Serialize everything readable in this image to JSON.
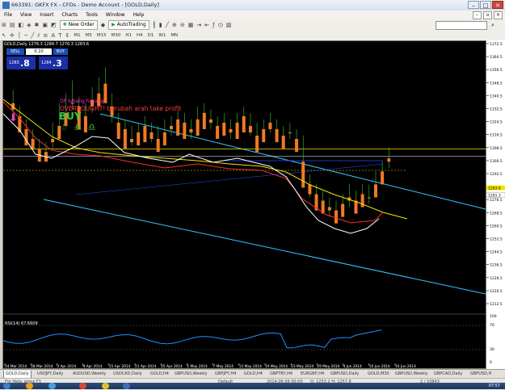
{
  "window": {
    "title": "663391: GKFX FX - CFDs - Demo Account - [GOLD,Daily]"
  },
  "menu": [
    "File",
    "View",
    "Insert",
    "Charts",
    "Tools",
    "Window",
    "Help"
  ],
  "toolbar": {
    "new_order": "New Order",
    "autotrading": "AutoTrading"
  },
  "timeframes": [
    "M1",
    "M5",
    "M15",
    "M30",
    "H1",
    "H4",
    "D1",
    "W1",
    "MN"
  ],
  "chart": {
    "header": "GOLD,Daily 1276.3 1284.7 1276.3 1283.6",
    "trade": {
      "sell": "SELL",
      "buy": "BUY",
      "lot": "0.10",
      "bid_small": "1283",
      "bid_big": ".8",
      "ask_small": "1284",
      "ask_big": ".3"
    },
    "annotations": {
      "line1": "OP lubang hasang",
      "line2": "OVERBOUGHT! berubah arah take profit",
      "line3": "BUY",
      "glyphs": "☃ ♎ ♎"
    },
    "price_labels": [
      "1372.5",
      "1364.5",
      "1356.5",
      "1348.5",
      "1340.5",
      "1332.5",
      "1324.5",
      "1316.5",
      "1308.5",
      "1300.5",
      "1292.5",
      "1284.5",
      "1276.5",
      "1268.5",
      "1260.5",
      "1252.5",
      "1244.5",
      "1236.5",
      "1228.5",
      "1220.5",
      "1212.5"
    ],
    "current_price": "1283.8",
    "current_price2": "1281.3",
    "date_labels": [
      "24 Mar 2014",
      "28 Mar 2014",
      "3 Apr 2014",
      "9 Apr 2014",
      "15 Apr 2014",
      "21 Apr 2014",
      "25 Apr 2014",
      "1 May 2014",
      "7 May 2014",
      "13 May 2014",
      "19 May 2014",
      "23 May 2014",
      "29 May 2014",
      "4 Jun 2014",
      "10 Jun 2014",
      "16 Jun 2014"
    ],
    "rsi": {
      "label": "RSI(14) 67.6609",
      "levels": [
        "100",
        "70",
        "30",
        "0"
      ]
    },
    "colors": {
      "background": "#000000",
      "channel": "#32c8ff",
      "ema_red": "#ff2b2b",
      "ema_yellow": "#f2e600",
      "ema_white": "#ffffff",
      "bull": "#3b7cff",
      "bear": "#f07a24",
      "rsi": "#1e90ff"
    }
  },
  "tabs": [
    "GOLD,Daily",
    "USDJPY,Daily",
    "AUDUSD,Weekly",
    "USDCAD,Daily",
    "GOLD,H4",
    "GBPUSD,Weekly",
    "GBPJPY,H4",
    "GOLD,H4",
    "GBPTRY,H4",
    "EURGBP,H4",
    "GBPUSD,Daily",
    "GOLD,M30",
    "GBPUSD,Weekly",
    "GBPCAD,Daily",
    "GBPUSD,H"
  ],
  "status": {
    "help": "For Help, press F1",
    "profile": "Default",
    "datetime": "2014.06.06 00:00",
    "values": "O: 1253.2   H: 1257.8",
    "traffic": "2 / 10843"
  },
  "taskbar": {
    "clock": "07:57"
  }
}
